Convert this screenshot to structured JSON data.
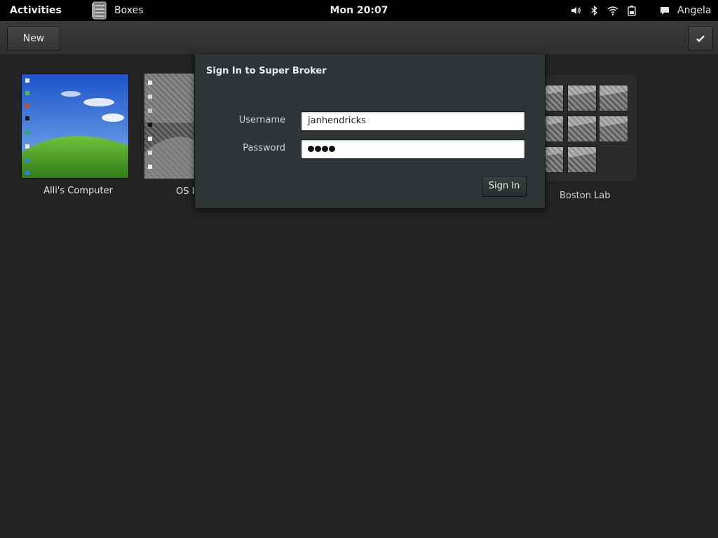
{
  "topbar": {
    "activities": "Activities",
    "app_name": "Boxes",
    "clock": "Mon 20:07",
    "user": "Angela",
    "icons": [
      "volume-icon",
      "bluetooth-icon",
      "wifi-icon",
      "battery-icon",
      "chat-icon"
    ]
  },
  "headerbar": {
    "new_label": "New",
    "select_icon": "checkmark-icon"
  },
  "collection": [
    {
      "label": "Alli's Computer"
    },
    {
      "label": "OS I"
    },
    {
      "label": "Boston Lab"
    }
  ],
  "dialog": {
    "title": "Sign In to Super Broker",
    "username_label": "Username",
    "username_value": "janhendricks",
    "password_label": "Password",
    "password_masked_length": 4,
    "signin_label": "Sign In"
  },
  "colors": {
    "background": "#232323",
    "topbar": "#000000",
    "dialog": "#2f3537"
  }
}
